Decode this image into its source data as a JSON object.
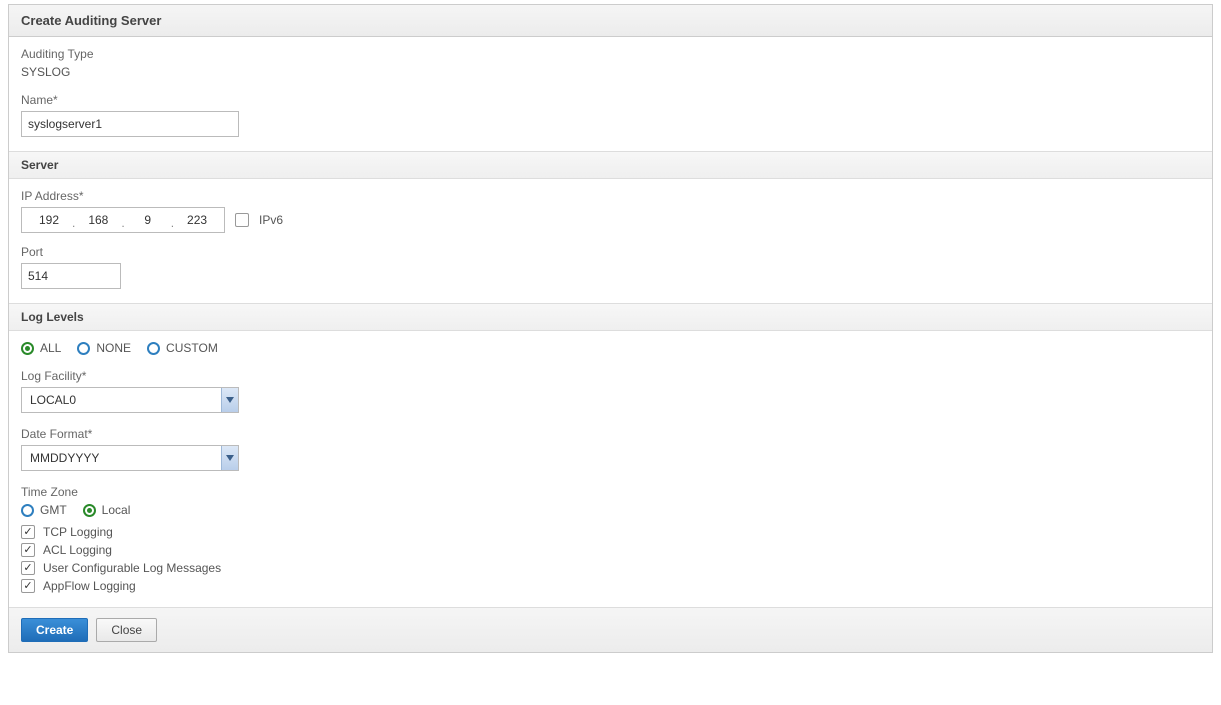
{
  "header": {
    "title": "Create Auditing Server"
  },
  "auditing": {
    "type_label": "Auditing Type",
    "type_value": "SYSLOG",
    "name_label": "Name*",
    "name_value": "syslogserver1"
  },
  "server": {
    "section_title": "Server",
    "ip_label": "IP Address*",
    "ip": {
      "o1": "192",
      "o2": "168",
      "o3": "9",
      "o4": "223"
    },
    "ipv6_label": "IPv6",
    "ipv6_checked": false,
    "port_label": "Port",
    "port_value": "514"
  },
  "loglevels": {
    "section_title": "Log Levels",
    "radios": {
      "all": "ALL",
      "none": "NONE",
      "custom": "CUSTOM",
      "selected": "all"
    },
    "log_facility_label": "Log Facility*",
    "log_facility_value": "LOCAL0",
    "date_format_label": "Date Format*",
    "date_format_value": "MMDDYYYY",
    "timezone_label": "Time Zone",
    "timezone": {
      "gmt": "GMT",
      "local": "Local",
      "selected": "local"
    },
    "checks": {
      "tcp": {
        "label": "TCP Logging",
        "checked": true
      },
      "acl": {
        "label": "ACL Logging",
        "checked": true
      },
      "ucfg": {
        "label": "User Configurable Log Messages",
        "checked": true
      },
      "appflow": {
        "label": "AppFlow Logging",
        "checked": true
      }
    }
  },
  "footer": {
    "create": "Create",
    "close": "Close"
  }
}
